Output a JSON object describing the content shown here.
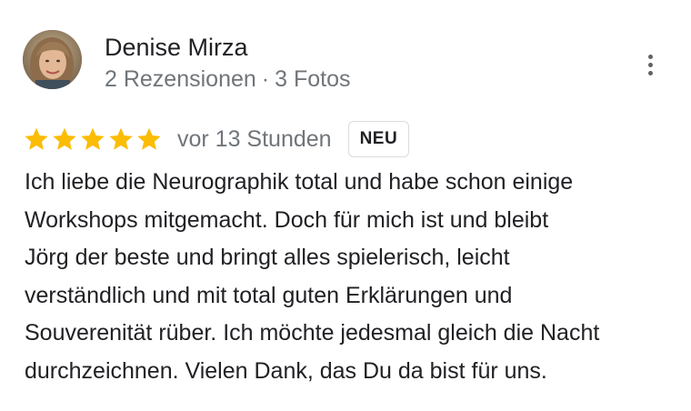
{
  "review": {
    "author": {
      "name": "Denise Mirza",
      "reviews_count": "2 Rezensionen",
      "separator": "·",
      "photos_count": "3 Fotos",
      "avatar_icon": "profile-photo"
    },
    "menu_icon": "more-vert-icon",
    "rating": {
      "stars": 5,
      "max_stars": 5,
      "star_color": "#fbbc04"
    },
    "time_ago": "vor 13 Stunden",
    "badge": "NEU",
    "text_lines": [
      "Ich liebe die Neurographik total und habe schon einige",
      "Workshops mitgemacht. Doch für mich ist und bleibt",
      "Jörg der beste und bringt alles spielerisch, leicht",
      "verständlich und mit total guten Erklärungen und",
      "Souverenität rüber. Ich möchte jedesmal gleich die Nacht",
      "durchzeichnen. Vielen Dank, das Du da bist für uns."
    ]
  }
}
